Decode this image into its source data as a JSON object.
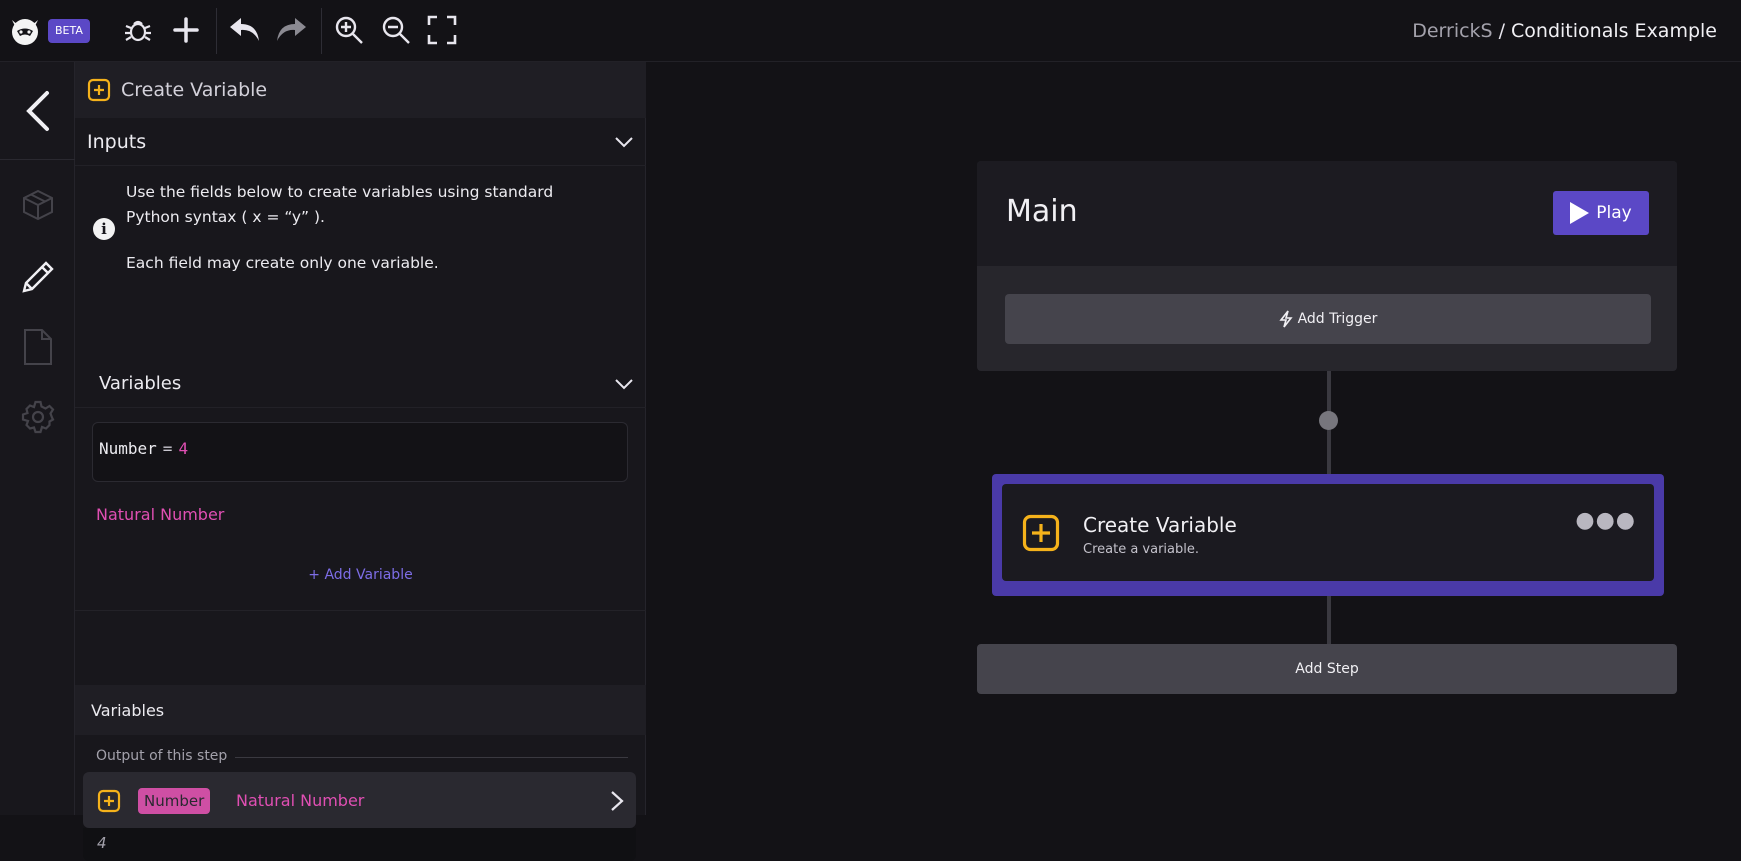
{
  "app": {
    "badge": "BETA"
  },
  "breadcrumb": {
    "user": "DerrickS",
    "separator": "/",
    "project": "Conditionals Example"
  },
  "toolbar": {
    "icons": [
      "bug-icon",
      "plus-icon",
      "undo-icon",
      "redo-icon",
      "zoom-in-icon",
      "zoom-out-icon",
      "fullscreen-icon"
    ]
  },
  "rail": {
    "items": [
      "back-icon",
      "package-icon",
      "pencil-icon",
      "document-icon",
      "gear-icon"
    ]
  },
  "panel": {
    "title": "Create Variable",
    "inputs_label": "Inputs",
    "info_text": "Use the fields below to create variables using standard Python syntax ( x = “y” ).",
    "info_text2": "Each field may create only one variable.",
    "variables_label": "Variables",
    "field": {
      "name": "Number",
      "operator": "=",
      "value": "4"
    },
    "field_type": "Natural Number",
    "add_variable": "+ Add Variable"
  },
  "output": {
    "section_title": "Variables",
    "output_label": "Output of this step",
    "var_name": "Number",
    "var_type": "Natural Number",
    "var_value": "4"
  },
  "canvas": {
    "main_title": "Main",
    "play_label": "Play",
    "trigger_label": "Add Trigger",
    "step_title": "Create Variable",
    "step_subtitle": "Create a variable.",
    "add_step_label": "Add Step"
  },
  "colors": {
    "accent": "#5b48c6",
    "step_border": "#4a3aa8",
    "variable_pink": "#e04fb3",
    "icon_yellow": "#f5b21b"
  }
}
